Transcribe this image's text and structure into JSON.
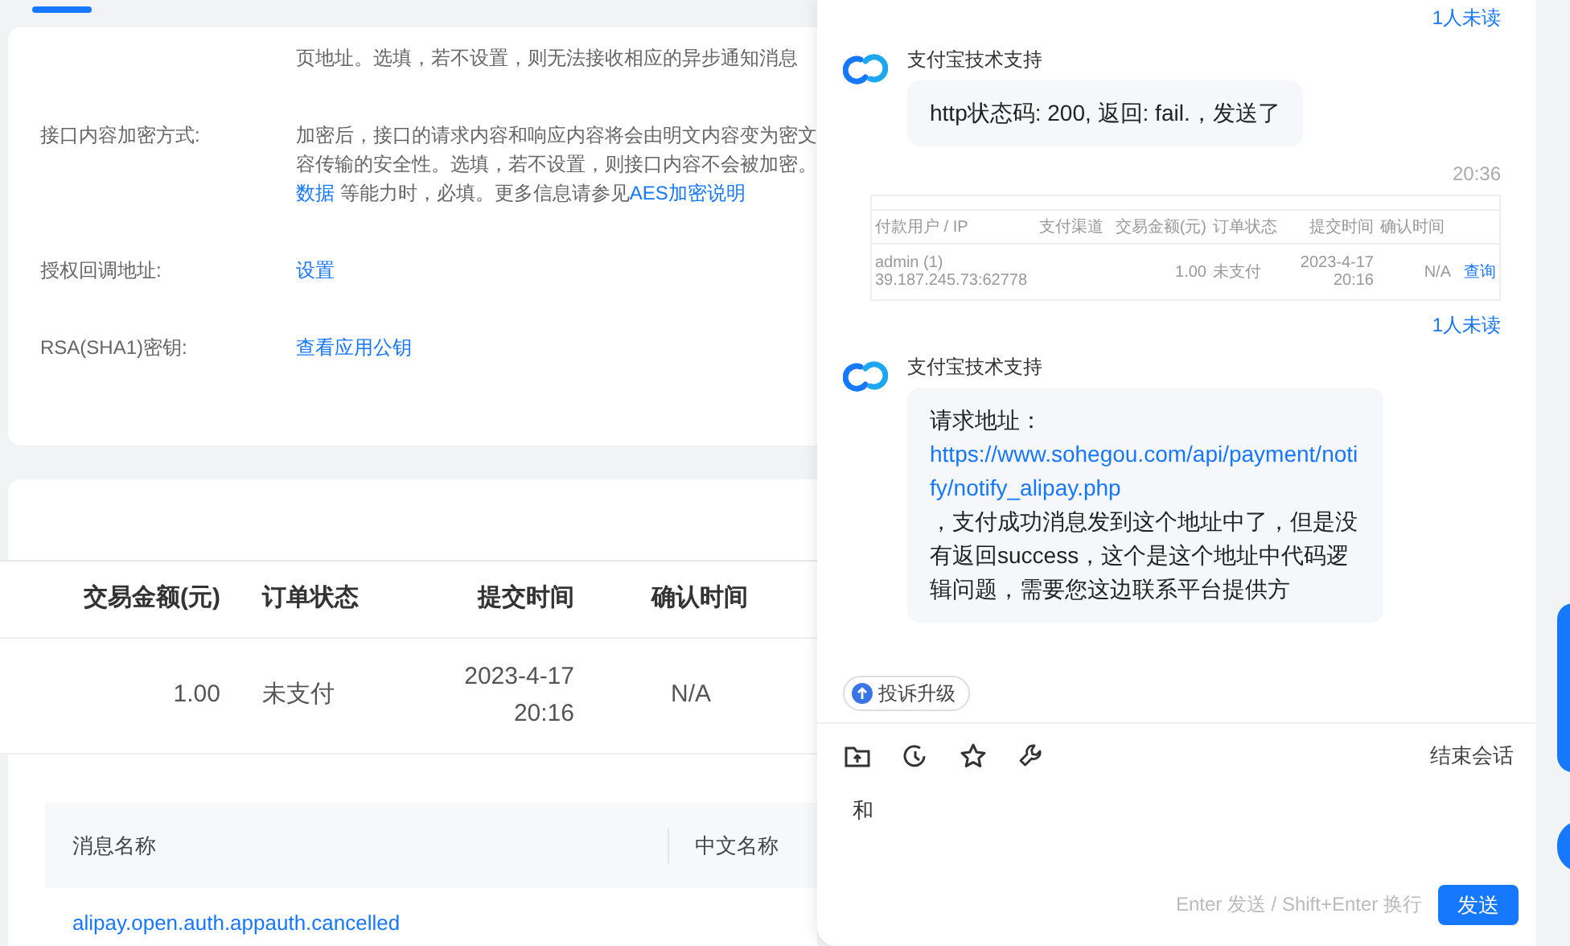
{
  "settings": [
    {
      "kind": "note",
      "lines": [
        [
          {
            "text": "页地址。选填，若不设置，则无法接收相应的异步通知消息"
          }
        ]
      ]
    },
    {
      "kind": "note",
      "label": "接口内容加密方式:",
      "lines": [
        [
          {
            "text": "加密后，接口的请求内容和响应内容将会由明文内容变为密文"
          }
        ],
        [
          {
            "text": "容传输的安全性。选填，若不设置，则接口内容不会被加密。"
          }
        ],
        [
          {
            "text": "数据",
            "link": true
          },
          {
            "text": " 等能力时，必填。更多信息请参见"
          },
          {
            "text": "AES加密说明",
            "link": true
          }
        ]
      ]
    },
    {
      "kind": "link",
      "label": "授权回调地址:",
      "link": "设置"
    },
    {
      "kind": "link",
      "label": "RSA(SHA1)密钥:",
      "link": "查看应用公钥"
    }
  ],
  "order_table": {
    "columns": [
      "交易金额(元)",
      "订单状态",
      "提交时间",
      "确认时间"
    ],
    "rows": [
      [
        [
          "1.00"
        ],
        [
          "未支付"
        ],
        [
          "2023-4-17",
          "20:16"
        ],
        [
          "N/A"
        ]
      ]
    ]
  },
  "message_table": {
    "columns": [
      "消息名称",
      "中文名称"
    ],
    "rows": [
      {
        "name": "alipay.open.auth.appauth.cancelled"
      }
    ]
  },
  "chat": {
    "messages": [
      {
        "kind": "receipt",
        "text": "1人未读"
      },
      {
        "kind": "text",
        "sender": "支付宝技术支持",
        "parts": [
          {
            "text": "http状态码: 200, 返回: fail.，发送了"
          }
        ]
      },
      {
        "kind": "time",
        "text": "20:36"
      },
      {
        "kind": "image",
        "columns": [
          "付款用户 / IP",
          "支付渠道",
          "交易金额(元)",
          "订单状态",
          "提交时间",
          "确认时间"
        ],
        "row": {
          "user": [
            "admin (1)",
            "39.187.245.73:62778"
          ],
          "amount": [
            "1.00"
          ],
          "status": [
            "未支付"
          ],
          "submitted": [
            "2023-4-17",
            "20:16"
          ],
          "confirmed": [
            "N/A"
          ],
          "action": [
            "查询"
          ]
        }
      },
      {
        "kind": "receipt",
        "text": "1人未读"
      },
      {
        "kind": "text",
        "sender": "支付宝技术支持",
        "parts": [
          {
            "text": "请求地址："
          },
          {
            "text": "https://www.sohegou.com/api/payment/notify/notify_alipay.php",
            "link": true
          },
          {
            "text": "，支付成功消息发到这个地址中了，但是没有返回success，这个是这个地址中代码逻辑问题，需要您这边联系平台提供方"
          }
        ]
      }
    ],
    "escalate_button": "投诉升级",
    "end_button": "结束会话",
    "input": {
      "value": "和",
      "hint": "Enter 发送 / Shift+Enter 换行"
    },
    "send_button": "发送"
  }
}
